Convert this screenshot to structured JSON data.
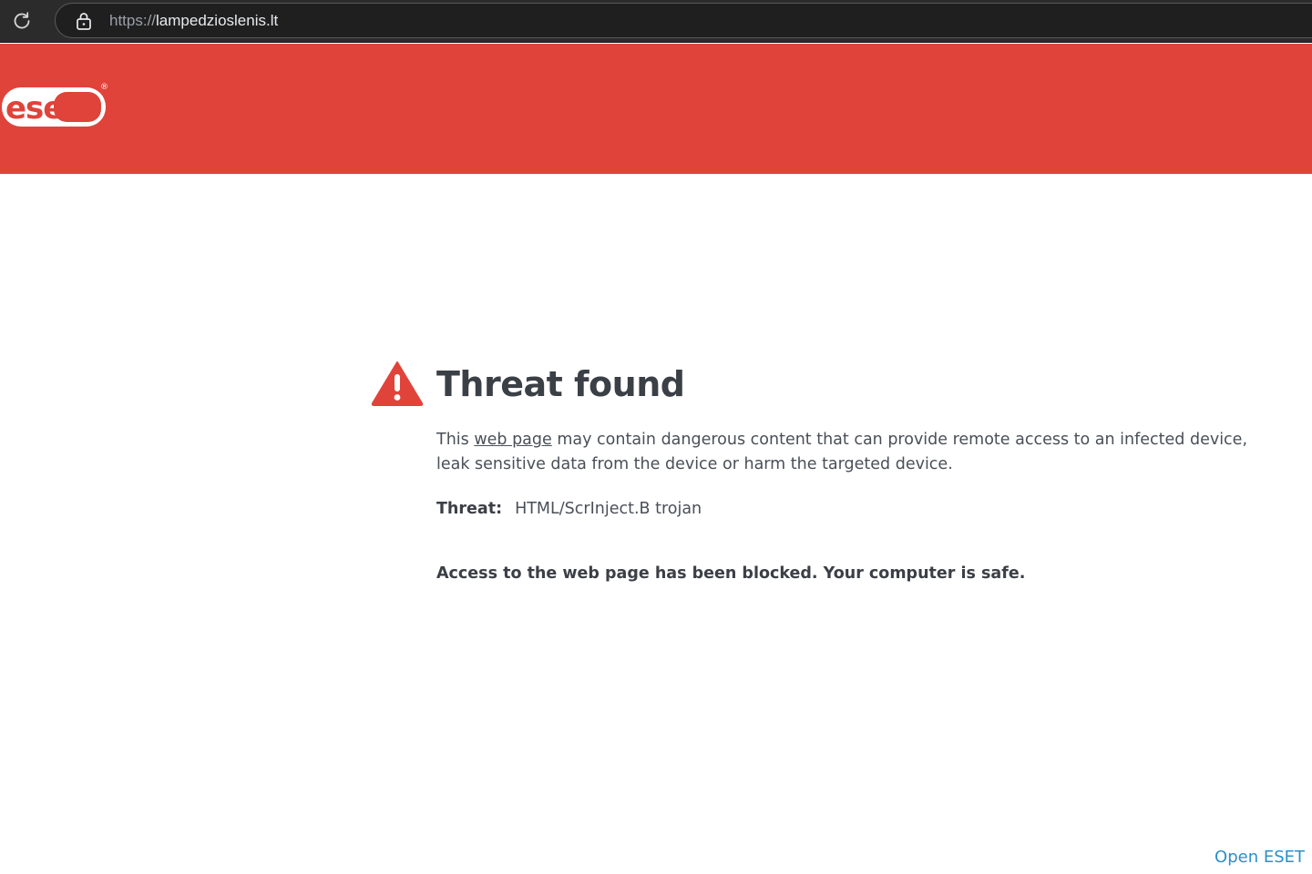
{
  "browser": {
    "url_scheme": "https://",
    "url_host": "lampedzioslenis.lt"
  },
  "header": {
    "logo_text": "eset",
    "logo_mark": "®",
    "brand_color": "#e0433a"
  },
  "icons": {
    "reload": "reload-icon",
    "lock": "lock-icon",
    "warning": "warning-triangle-icon"
  },
  "content": {
    "title": "Threat found",
    "description_before": "This ",
    "description_link": "web page",
    "description_after": " may contain dangerous content that can provide remote access to an infected device, leak sensitive data from the device or harm the targeted device.",
    "threat_label": "Threat:",
    "threat_value": "HTML/ScrInject.B trojan",
    "blocked_message": "Access to the web page has been blocked. Your computer is safe."
  },
  "footer": {
    "open_eset_label": "Open ESET",
    "link_color": "#2b8fc9"
  }
}
